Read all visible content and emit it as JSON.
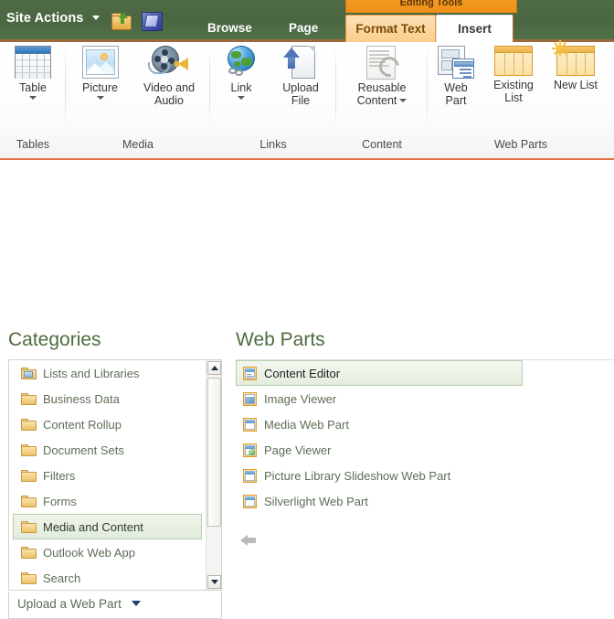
{
  "header": {
    "site_actions": "Site Actions",
    "quick_icons": [
      {
        "name": "navigate-up-icon"
      },
      {
        "name": "sharepoint-designer-icon"
      }
    ],
    "contextual_tab_group": "Editing Tools",
    "tabs": [
      {
        "label": "Browse",
        "state": "normal"
      },
      {
        "label": "Page",
        "state": "normal"
      },
      {
        "label": "Format Text",
        "state": "contextual"
      },
      {
        "label": "Insert",
        "state": "active"
      }
    ]
  },
  "ribbon": {
    "groups": [
      {
        "label": "Tables",
        "buttons": [
          {
            "label": "Table",
            "icon": "table-icon",
            "has_dropdown": true
          }
        ]
      },
      {
        "label": "Media",
        "buttons": [
          {
            "label": "Picture",
            "icon": "picture-icon",
            "has_dropdown": true
          },
          {
            "label": "Video and Audio",
            "icon": "video-audio-icon",
            "has_dropdown": false
          }
        ]
      },
      {
        "label": "Links",
        "buttons": [
          {
            "label": "Link",
            "icon": "link-globe-icon",
            "has_dropdown": true
          },
          {
            "label": "Upload File",
            "icon": "upload-file-icon",
            "has_dropdown": false
          }
        ]
      },
      {
        "label": "Content",
        "buttons": [
          {
            "label": "Reusable Content",
            "icon": "reusable-content-icon",
            "has_dropdown": true
          }
        ]
      },
      {
        "label": "Web Parts",
        "buttons": [
          {
            "label": "Web Part",
            "icon": "web-part-icon",
            "has_dropdown": false
          },
          {
            "label": "Existing List",
            "icon": "existing-list-icon",
            "has_dropdown": false
          },
          {
            "label": "New List",
            "icon": "new-list-icon",
            "has_dropdown": false
          }
        ]
      }
    ]
  },
  "categories_panel": {
    "title": "Categories",
    "items": [
      {
        "label": "Lists and Libraries",
        "icon": "folder-list-icon",
        "selected": false
      },
      {
        "label": "Business Data",
        "icon": "folder-icon",
        "selected": false
      },
      {
        "label": "Content Rollup",
        "icon": "folder-icon",
        "selected": false
      },
      {
        "label": "Document Sets",
        "icon": "folder-icon",
        "selected": false
      },
      {
        "label": "Filters",
        "icon": "folder-icon",
        "selected": false
      },
      {
        "label": "Forms",
        "icon": "folder-icon",
        "selected": false
      },
      {
        "label": "Media and Content",
        "icon": "folder-icon",
        "selected": true
      },
      {
        "label": "Outlook Web App",
        "icon": "folder-icon",
        "selected": false
      },
      {
        "label": "Search",
        "icon": "folder-icon",
        "selected": false
      }
    ],
    "footer": {
      "upload_label": "Upload a Web Part"
    }
  },
  "webparts_panel": {
    "title": "Web Parts",
    "items": [
      {
        "label": "Content Editor",
        "icon": "content-editor-icon",
        "selected": true
      },
      {
        "label": "Image Viewer",
        "icon": "image-viewer-icon",
        "selected": false
      },
      {
        "label": "Media Web Part",
        "icon": "media-web-part-icon",
        "selected": false
      },
      {
        "label": "Page Viewer",
        "icon": "page-viewer-icon",
        "selected": false
      },
      {
        "label": "Picture Library Slideshow Web Part",
        "icon": "picture-slideshow-icon",
        "selected": false
      },
      {
        "label": "Silverlight Web Part",
        "icon": "silverlight-icon",
        "selected": false
      }
    ]
  },
  "colors": {
    "header_green": "#4a6741",
    "contextual_orange": "#f59b21",
    "ribbon_rule": "#e2724a",
    "selection_green": "#b9cdb0",
    "title_text": "#4e6b3f"
  }
}
